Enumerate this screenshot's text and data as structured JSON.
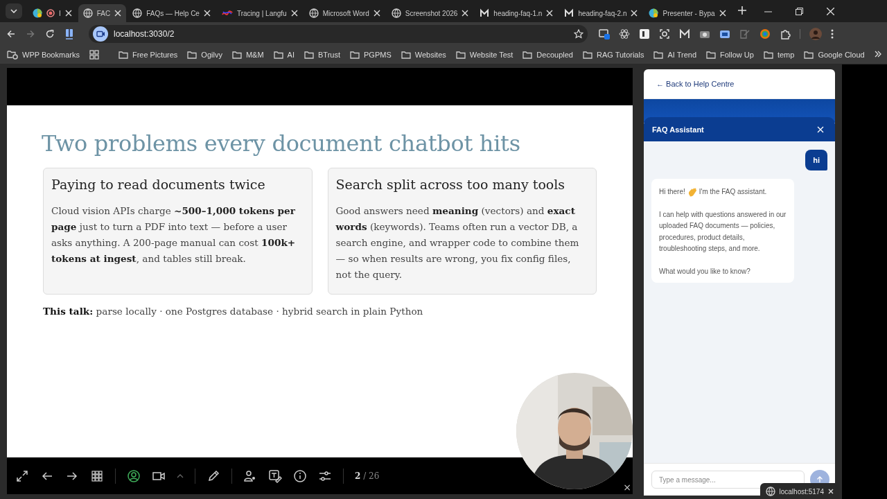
{
  "browser": {
    "tabs": [
      {
        "title": "I",
        "kind": "recording",
        "selected": false
      },
      {
        "title": "FAC",
        "kind": "globe",
        "selected": true
      },
      {
        "title": "FAQs — Help Ce",
        "kind": "globe",
        "selected": false
      },
      {
        "title": "Tracing | Langfu",
        "kind": "squiggle",
        "selected": false
      },
      {
        "title": "Microsoft Word",
        "kind": "globe",
        "selected": false
      },
      {
        "title": "Screenshot 2026",
        "kind": "globe",
        "selected": false
      },
      {
        "title": "heading-faq-1.n",
        "kind": "mlogo",
        "selected": false
      },
      {
        "title": "heading-faq-2.n",
        "kind": "mlogo",
        "selected": false
      },
      {
        "title": "Presenter - Bypa",
        "kind": "colorball",
        "selected": false
      }
    ],
    "address": "localhost:3030/2",
    "bookmarks": [
      {
        "label": "WPP Bookmarks",
        "kind": "special"
      },
      {
        "label": "Free Pictures",
        "kind": "folder"
      },
      {
        "label": "Ogilvy",
        "kind": "folder"
      },
      {
        "label": "M&M",
        "kind": "folder"
      },
      {
        "label": "AI",
        "kind": "folder"
      },
      {
        "label": "BTrust",
        "kind": "folder"
      },
      {
        "label": "PGPMS",
        "kind": "folder"
      },
      {
        "label": "Websites",
        "kind": "folder"
      },
      {
        "label": "Website Test",
        "kind": "folder"
      },
      {
        "label": "Decoupled",
        "kind": "folder"
      },
      {
        "label": "RAG Tutorials",
        "kind": "folder"
      },
      {
        "label": "AI Trend",
        "kind": "folder"
      },
      {
        "label": "Follow Up",
        "kind": "folder"
      },
      {
        "label": "temp",
        "kind": "folder"
      },
      {
        "label": "Google Cloud",
        "kind": "folder"
      }
    ]
  },
  "slide": {
    "title": "Two problems every document chatbot hits",
    "cards": [
      {
        "heading": "Paying to read documents twice",
        "body": "Cloud vision APIs charge **~500–1,000 tokens per page** just to turn a PDF into text — before a user asks anything. A 200-page manual can cost **100k+ tokens at ingest**, and tables still break."
      },
      {
        "heading": "Search split across too many tools",
        "body": "Good answers need **meaning** (vectors) and **exact words** (keywords). Teams often run a vector DB, a search engine, and wrapper code to combine them — so when results are wrong, you fix config files, not the query."
      }
    ],
    "talk": "**This talk:** parse locally · one Postgres database · hybrid search in plain Python",
    "page": "**2** / 26",
    "camera_on": true,
    "close": "×"
  },
  "chat": {
    "back_link": "← Back to Help Centre",
    "title": "FAQ Assistant",
    "messages": [
      {
        "kind": "user",
        "text": "hi"
      },
      {
        "kind": "bot",
        "greeting_before": "Hi there!",
        "greeting_after": "I'm the FAQ assistant.",
        "paragraphs": [
          "I can help with questions answered in our uploaded FAQ documents — policies, procedures, product details, troubleshooting steps, and more.",
          "What would you like to know?"
        ]
      }
    ],
    "input": {
      "placeholder": "Type a message..."
    },
    "tooltip": "localhost:5174"
  }
}
